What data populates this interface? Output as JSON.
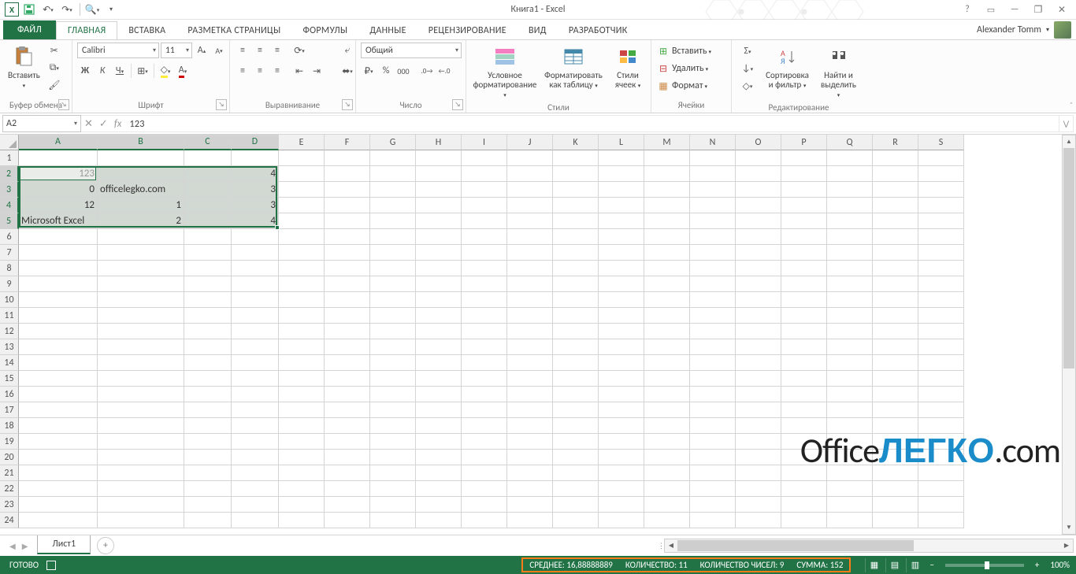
{
  "title": "Книга1 - Excel",
  "user": "Alexander Tomm",
  "qat": {
    "excel": "XL",
    "save": "💾",
    "undo": "↶",
    "redo": "↷",
    "preview": "🔍",
    "more": "▾"
  },
  "tabs": {
    "file": "ФАЙЛ",
    "home": "ГЛАВНАЯ",
    "insert": "ВСТАВКА",
    "pageLayout": "РАЗМЕТКА СТРАНИЦЫ",
    "formulas": "ФОРМУЛЫ",
    "data": "ДАННЫЕ",
    "review": "РЕЦЕНЗИРОВАНИЕ",
    "view": "ВИД",
    "developer": "РАЗРАБОТЧИК"
  },
  "ribbon": {
    "clipboard": {
      "paste": "Вставить",
      "label": "Буфер обмена"
    },
    "font": {
      "name": "Calibri",
      "size": "11",
      "label": "Шрифт",
      "bold": "Ж",
      "italic": "К",
      "underline": "Ч"
    },
    "align": {
      "label": "Выравнивание",
      "wrap": "⤶",
      "merge": "⬌"
    },
    "number": {
      "format": "Общий",
      "label": "Число"
    },
    "styles": {
      "cond": "Условное форматирование",
      "table": "Форматировать как таблицу",
      "cell": "Стили ячеек",
      "label": "Стили"
    },
    "cells": {
      "insert": "Вставить",
      "delete": "Удалить",
      "format": "Формат",
      "label": "Ячейки"
    },
    "editing": {
      "sort": "Сортировка и фильтр",
      "find": "Найти и выделить",
      "label": "Редактирование"
    }
  },
  "namebox": "A2",
  "formula": "123",
  "columns": [
    "A",
    "B",
    "C",
    "D",
    "E",
    "F",
    "G",
    "H",
    "I",
    "J",
    "K",
    "L",
    "M",
    "N",
    "O",
    "P",
    "Q",
    "R",
    "S"
  ],
  "colwidths": {
    "A": 100,
    "B": 110,
    "C": 60,
    "D": 60,
    "def": 58
  },
  "cells": {
    "A2": "123",
    "D2": "4",
    "A3": "0",
    "B3": "officelegko.com",
    "D3": "3",
    "A4": "12",
    "B4": "1",
    "D4": "3",
    "A5": "Microsoft Excel",
    "B5": "2",
    "D5": "4"
  },
  "numcells": [
    "A2",
    "A3",
    "A4",
    "B4",
    "B5",
    "D2",
    "D3",
    "D4",
    "D5"
  ],
  "selectionRange": "A2:D5",
  "activeCell": "A2",
  "sheet": "Лист1",
  "status": {
    "ready": "ГОТОВО",
    "avg": "СРЕДНЕЕ: 16,88888889",
    "count": "КОЛИЧЕСТВО: 11",
    "numcount": "КОЛИЧЕСТВО ЧИСЕЛ: 9",
    "sum": "СУММА: 152",
    "zoom": "100%"
  },
  "watermark": {
    "a": "Office",
    "b": "ЛЕГКО",
    "c": ".com"
  }
}
